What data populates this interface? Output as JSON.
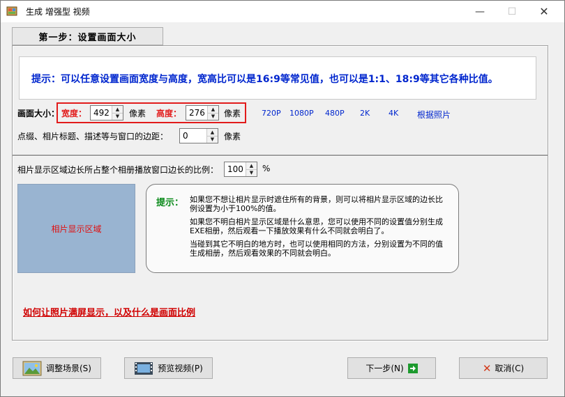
{
  "window": {
    "title": "生成 增强型 视频",
    "minimize_glyph": "—",
    "maximize_glyph": "☐",
    "close_glyph": "✕"
  },
  "step": {
    "label": "第一步：设置画面大小"
  },
  "tip1": {
    "text": "提示：可以任意设置画面宽度与高度，宽高比可以是16:9等常见值，也可以是1:1、18:9等其它各种比值。"
  },
  "size": {
    "title": "画面大小：",
    "width_label": "宽度：",
    "width_value": "492",
    "width_unit": "像素",
    "height_label": "高度：",
    "height_value": "276",
    "height_unit": "像素",
    "presets": [
      "720P",
      "1080P",
      "480P",
      "2K",
      "4K",
      "根据照片"
    ]
  },
  "margin": {
    "label": "点缀、相片标题、描述等与窗口的边距：",
    "value": "0",
    "unit": "像素"
  },
  "ratio": {
    "label": "相片显示区域边长所占整个相册播放窗口边长的比例：",
    "value": "100",
    "unit": "%"
  },
  "photo_area": {
    "label": "相片显示区域"
  },
  "tip2": {
    "label": "提示：",
    "para1": "如果您不想让相片显示时遮住所有的背景，则可以将相片显示区域的边长比例设置为小于100%的值。",
    "para2": "如果您不明白相片显示区域是什么意思，您可以使用不同的设置值分别生成EXE相册，然后观看一下播放效果有什么不同就会明白了。",
    "para3": "当碰到其它不明白的地方时，也可以使用相同的方法，分别设置为不同的值生成相册，然后观看效果的不同就会明白。"
  },
  "link": {
    "text": "如何让照片满屏显示，以及什么是画面比例"
  },
  "buttons": {
    "adjust": "调整场景(S)",
    "preview": "预览视频(P)",
    "next": "下一步(N)",
    "cancel": "取消(C)"
  },
  "icons": {
    "app": "app-icon",
    "adjust": "landscape-icon",
    "preview": "filmstrip-icon",
    "next": "arrow-right-icon",
    "cancel": "x-icon"
  },
  "colors": {
    "tip_blue": "#0026ce",
    "red": "#e21b1b",
    "green": "#0a8a1a",
    "photo_area": "#99b4d1"
  }
}
